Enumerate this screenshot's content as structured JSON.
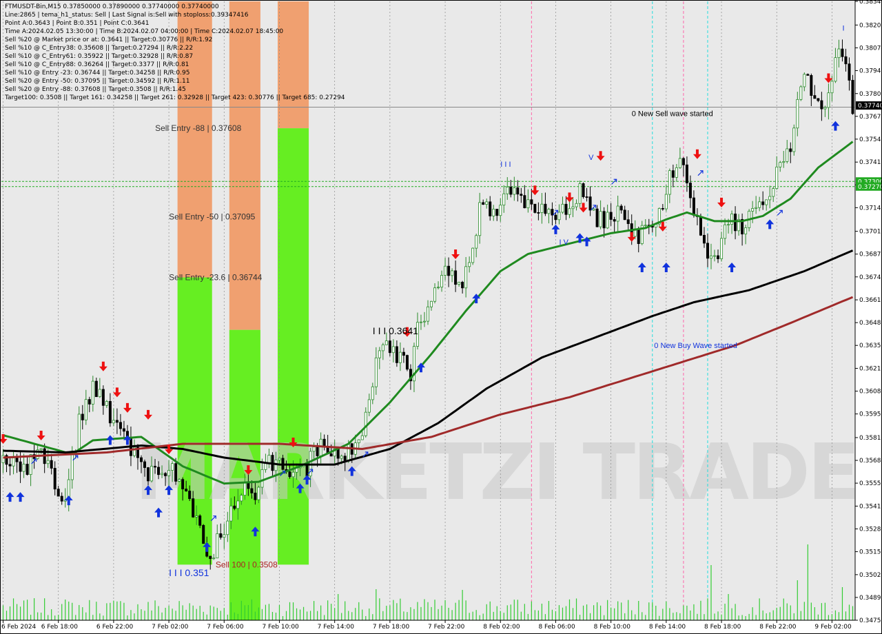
{
  "header": {
    "lines": [
      "FTMUSDT-Bin,M15  0.37850000 0.37890000 0.37740000 0.37740000",
      "Line:2865 | tema_h1_status: Sell | Last Signal is:Sell with stoploss:0.39347416",
      "Point A:0.3643 | Point B:0.351 | Point C:0.3641",
      "Time A:2024.02.05 13:30:00 | Time B:2024.02.07 04:00:00 | Time C:2024.02.07 18:45:00",
      "Sell %20 @ Market price or at: 0.3641 || Target:0.30776 || R/R:1.92",
      "Sell %10 @ C_Entry38: 0.35608 || Target:0.27294 || R/R:2.22",
      "Sell %10 @ C_Entry61: 0.35922 || Target:0.32928 || R/R:0.87",
      "Sell %10 @ C_Entry88: 0.36264 || Target:0.3377 || R/R:0.81",
      "Sell %10 @ Entry -23: 0.36744 || Target:0.34258 || R/R:0.95",
      "Sell %20 @ Entry -50: 0.37095 || Target:0.34592 || R/R:1.11",
      "Sell %20 @ Entry -88: 0.37608 || Target:0.3508 || R/R:1.45",
      "Target100: 0.3508 || Target 161: 0.34258 || Target 261: 0.32928 || Target 423: 0.30776 || Target 685: 0.27294"
    ]
  },
  "watermark": "MARKETZI TRADE",
  "colors": {
    "background": "#e9e9e9",
    "grid": "#8a8a8a",
    "bull": "#2a8a2a",
    "bear": "#000000",
    "ma_fast": "#1f8a1f",
    "ma_slow": "#000000",
    "ma_long": "#a02a2a",
    "zone_orange": "#f0a070",
    "zone_green": "#66ee22",
    "sell_arrow": "#ee1111",
    "buy_arrow": "#1133dd",
    "volume": "#33cc33",
    "magenta_line": "#ff66aa",
    "cyan_line": "#22dddd",
    "level_line": "#22aa22"
  },
  "chart_data": {
    "type": "candlestick",
    "symbol": "FTMUSDT-Bin",
    "timeframe": "M15",
    "ylim": [
      0.34758,
      0.38343
    ],
    "y_ticks": [
      0.38343,
      0.38206,
      0.38074,
      0.37942,
      0.37809,
      0.37677,
      0.37545,
      0.37412,
      0.3728,
      0.37148,
      0.37011,
      0.36879,
      0.36747,
      0.36614,
      0.36482,
      0.3635,
      0.36217,
      0.36085,
      0.35953,
      0.35816,
      0.35684,
      0.35552,
      0.35419,
      0.35287,
      0.35155,
      0.35022,
      0.3489,
      0.34758
    ],
    "x_labels": [
      "6 Feb 2024",
      "6 Feb 18:00",
      "6 Feb 22:00",
      "7 Feb 02:00",
      "7 Feb 06:00",
      "7 Feb 10:00",
      "7 Feb 14:00",
      "7 Feb 18:00",
      "7 Feb 22:00",
      "8 Feb 02:00",
      "8 Feb 06:00",
      "8 Feb 10:00",
      "8 Feb 14:00",
      "8 Feb 18:00",
      "8 Feb 22:00",
      "9 Feb 02:00"
    ],
    "x_label_index": [
      0,
      16,
      32,
      48,
      64,
      80,
      96,
      112,
      128,
      144,
      160,
      176,
      192,
      208,
      224,
      240
    ],
    "bar_count": 247,
    "close_path": [
      [
        0,
        0.3567
      ],
      [
        6,
        0.3561
      ],
      [
        10,
        0.358
      ],
      [
        14,
        0.356
      ],
      [
        18,
        0.3545
      ],
      [
        22,
        0.359
      ],
      [
        26,
        0.3612
      ],
      [
        30,
        0.3598
      ],
      [
        34,
        0.3585
      ],
      [
        38,
        0.357
      ],
      [
        42,
        0.3562
      ],
      [
        46,
        0.3565
      ],
      [
        50,
        0.356
      ],
      [
        54,
        0.3545
      ],
      [
        58,
        0.3525
      ],
      [
        60,
        0.3512
      ],
      [
        62,
        0.352
      ],
      [
        66,
        0.3538
      ],
      [
        70,
        0.3555
      ],
      [
        72,
        0.3545
      ],
      [
        76,
        0.3565
      ],
      [
        80,
        0.3572
      ],
      [
        84,
        0.356
      ],
      [
        88,
        0.3565
      ],
      [
        92,
        0.3578
      ],
      [
        96,
        0.357
      ],
      [
        100,
        0.3573
      ],
      [
        104,
        0.3582
      ],
      [
        106,
        0.3605
      ],
      [
        108,
        0.3625
      ],
      [
        110,
        0.364
      ],
      [
        114,
        0.3628
      ],
      [
        118,
        0.362
      ],
      [
        120,
        0.3645
      ],
      [
        124,
        0.3665
      ],
      [
        128,
        0.3682
      ],
      [
        132,
        0.3668
      ],
      [
        136,
        0.369
      ],
      [
        138,
        0.3718
      ],
      [
        142,
        0.3712
      ],
      [
        146,
        0.3728
      ],
      [
        150,
        0.3723
      ],
      [
        152,
        0.3715
      ],
      [
        156,
        0.3712
      ],
      [
        160,
        0.3705
      ],
      [
        164,
        0.3718
      ],
      [
        168,
        0.3726
      ],
      [
        170,
        0.3712
      ],
      [
        174,
        0.3706
      ],
      [
        178,
        0.3712
      ],
      [
        182,
        0.3698
      ],
      [
        186,
        0.37
      ],
      [
        190,
        0.3712
      ],
      [
        192,
        0.3728
      ],
      [
        196,
        0.374
      ],
      [
        198,
        0.3728
      ],
      [
        202,
        0.37
      ],
      [
        204,
        0.369
      ],
      [
        206,
        0.3683
      ],
      [
        208,
        0.3694
      ],
      [
        210,
        0.3706
      ],
      [
        214,
        0.3703
      ],
      [
        216,
        0.371
      ],
      [
        218,
        0.372
      ],
      [
        222,
        0.3718
      ],
      [
        224,
        0.3735
      ],
      [
        228,
        0.3752
      ],
      [
        230,
        0.3775
      ],
      [
        232,
        0.3796
      ],
      [
        234,
        0.3785
      ],
      [
        238,
        0.3772
      ],
      [
        240,
        0.379
      ],
      [
        242,
        0.3805
      ],
      [
        244,
        0.3793
      ],
      [
        246,
        0.3774
      ]
    ],
    "moving_averages": [
      {
        "color": "#1f8a1f",
        "values": [
          [
            0,
            0.3583
          ],
          [
            20,
            0.3572
          ],
          [
            26,
            0.358
          ],
          [
            40,
            0.3582
          ],
          [
            52,
            0.3565
          ],
          [
            64,
            0.3555
          ],
          [
            74,
            0.3556
          ],
          [
            86,
            0.3565
          ],
          [
            100,
            0.3578
          ],
          [
            112,
            0.3602
          ],
          [
            124,
            0.363
          ],
          [
            134,
            0.3655
          ],
          [
            144,
            0.3678
          ],
          [
            152,
            0.3688
          ],
          [
            164,
            0.3694
          ],
          [
            176,
            0.37
          ],
          [
            186,
            0.3703
          ],
          [
            192,
            0.3708
          ],
          [
            198,
            0.3712
          ],
          [
            206,
            0.3707
          ],
          [
            214,
            0.3707
          ],
          [
            220,
            0.371
          ],
          [
            228,
            0.372
          ],
          [
            236,
            0.3738
          ],
          [
            246,
            0.3753
          ]
        ]
      },
      {
        "color": "#000000",
        "values": [
          [
            0,
            0.3574
          ],
          [
            18,
            0.3573
          ],
          [
            40,
            0.3577
          ],
          [
            52,
            0.3575
          ],
          [
            64,
            0.357
          ],
          [
            80,
            0.3566
          ],
          [
            96,
            0.3566
          ],
          [
            112,
            0.3575
          ],
          [
            126,
            0.359
          ],
          [
            140,
            0.361
          ],
          [
            156,
            0.3628
          ],
          [
            172,
            0.364
          ],
          [
            188,
            0.3652
          ],
          [
            200,
            0.366
          ],
          [
            216,
            0.3667
          ],
          [
            232,
            0.3678
          ],
          [
            246,
            0.369
          ]
        ]
      },
      {
        "color": "#a02a2a",
        "values": [
          [
            0,
            0.357
          ],
          [
            30,
            0.3573
          ],
          [
            52,
            0.3578
          ],
          [
            80,
            0.3578
          ],
          [
            104,
            0.3575
          ],
          [
            124,
            0.3582
          ],
          [
            144,
            0.3595
          ],
          [
            164,
            0.3605
          ],
          [
            180,
            0.3615
          ],
          [
            196,
            0.3625
          ],
          [
            212,
            0.3635
          ],
          [
            228,
            0.3648
          ],
          [
            246,
            0.3663
          ]
        ]
      }
    ],
    "zones": [
      {
        "x0": 51,
        "x1": 61,
        "y0": 0.38343,
        "y1": 0.36744,
        "color": "orange"
      },
      {
        "x0": 51,
        "x1": 61,
        "y0": 0.36744,
        "y1": 0.3508,
        "color": "green"
      },
      {
        "x0": 66,
        "x1": 75,
        "y0": 0.38343,
        "y1": 0.3644,
        "color": "orange"
      },
      {
        "x0": 66,
        "x1": 75,
        "y0": 0.3644,
        "y1": 0.34758,
        "color": "green"
      },
      {
        "x0": 80,
        "x1": 89,
        "y0": 0.38343,
        "y1": 0.37608,
        "color": "orange"
      },
      {
        "x0": 80,
        "x1": 89,
        "y0": 0.37608,
        "y1": 0.3508,
        "color": "green"
      }
    ],
    "level_lines": [
      {
        "price": 0.3773,
        "color": "#888888",
        "dash": false
      },
      {
        "price": 0.373,
        "color": "#22aa22",
        "dash": true
      },
      {
        "price": 0.3727,
        "color": "#22aa22",
        "dash": true
      }
    ],
    "price_boxes": [
      {
        "price": 0.3774,
        "label": "0.37740",
        "bg": "#000000",
        "fg": "#ffffff"
      },
      {
        "price": 0.373,
        "label": "0.37300",
        "bg": "#22aa22",
        "fg": "#ffffff"
      },
      {
        "price": 0.3727,
        "label": "0.37270",
        "bg": "#22aa22",
        "fg": "#ffffff"
      }
    ],
    "vertical_lines": [
      {
        "x": 153,
        "color": "#ff66aa"
      },
      {
        "x": 188,
        "color": "#22dddd"
      },
      {
        "x": 197,
        "color": "#ff66aa"
      },
      {
        "x": 204,
        "color": "#22dddd"
      }
    ],
    "sell_arrows": [
      [
        0,
        0.3578
      ],
      [
        11,
        0.358
      ],
      [
        29,
        0.362
      ],
      [
        33,
        0.3605
      ],
      [
        36,
        0.3596
      ],
      [
        42,
        0.3592
      ],
      [
        48,
        0.3572
      ],
      [
        71,
        0.356
      ],
      [
        84,
        0.3576
      ],
      [
        117,
        0.364
      ],
      [
        131,
        0.3685
      ],
      [
        154,
        0.3722
      ],
      [
        164,
        0.3718
      ],
      [
        168,
        0.3712
      ],
      [
        173,
        0.3742
      ],
      [
        182,
        0.3695
      ],
      [
        191,
        0.3701
      ],
      [
        201,
        0.3743
      ],
      [
        208,
        0.3715
      ],
      [
        239,
        0.3787
      ]
    ],
    "buy_arrows": [
      [
        2,
        0.355
      ],
      [
        5,
        0.355
      ],
      [
        19,
        0.3548
      ],
      [
        31,
        0.3583
      ],
      [
        36,
        0.3583
      ],
      [
        42,
        0.3554
      ],
      [
        45,
        0.3541
      ],
      [
        48,
        0.3554
      ],
      [
        59,
        0.3521
      ],
      [
        73,
        0.353
      ],
      [
        86,
        0.3555
      ],
      [
        88,
        0.356
      ],
      [
        101,
        0.3565
      ],
      [
        121,
        0.3625
      ],
      [
        137,
        0.3665
      ],
      [
        160,
        0.3705
      ],
      [
        167,
        0.37
      ],
      [
        169,
        0.3698
      ],
      [
        185,
        0.3683
      ],
      [
        192,
        0.3683
      ],
      [
        211,
        0.3683
      ],
      [
        222,
        0.3708
      ],
      [
        241,
        0.3765
      ]
    ],
    "hollow_arrows": [
      [
        9,
        0.3568
      ],
      [
        21,
        0.357
      ],
      [
        61,
        0.3535
      ],
      [
        81,
        0.3561
      ],
      [
        89,
        0.3562
      ],
      [
        105,
        0.3572
      ],
      [
        160,
        0.3712
      ],
      [
        171,
        0.3715
      ],
      [
        177,
        0.373
      ],
      [
        202,
        0.3735
      ],
      [
        225,
        0.3712
      ]
    ],
    "annotations": [
      {
        "text": "Sell Entry -88 | 0.37608",
        "x": 56.5,
        "price": 0.37608,
        "color": "#333333",
        "size": 12,
        "anchor": "middle"
      },
      {
        "text": "Sell Entry -50 | 0.37095",
        "x": 60.5,
        "price": 0.37095,
        "color": "#333333",
        "size": 12,
        "anchor": "middle"
      },
      {
        "text": "Sell Entry -23.6 | 0.36744",
        "x": 61.5,
        "price": 0.36744,
        "color": "#333333",
        "size": 12,
        "anchor": "middle"
      },
      {
        "text": "Sell 100 | 0.3508",
        "x": 70.5,
        "price": 0.3508,
        "color": "#aa2222",
        "size": 12,
        "anchor": "middle"
      },
      {
        "text": "I I I 0.3641",
        "x": 107,
        "price": 0.3643,
        "color": "#000000",
        "size": 14,
        "anchor": "start"
      },
      {
        "text": "I I I 0.351",
        "x": 48,
        "price": 0.3503,
        "color": "#1133dd",
        "size": 14,
        "anchor": "start"
      },
      {
        "text": "I I I",
        "x": 144,
        "price": 0.374,
        "color": "#1133dd",
        "size": 11,
        "anchor": "start"
      },
      {
        "text": "I V",
        "x": 161,
        "price": 0.3695,
        "color": "#1133dd",
        "size": 11,
        "anchor": "start"
      },
      {
        "text": "V",
        "x": 169.5,
        "price": 0.3744,
        "color": "#1133dd",
        "size": 11,
        "anchor": "start"
      },
      {
        "text": "I",
        "x": 243,
        "price": 0.3819,
        "color": "#1133dd",
        "size": 11,
        "anchor": "start"
      },
      {
        "text": "0 New Sell wave started",
        "x": 182,
        "price": 0.37695,
        "color": "#000000",
        "size": 11,
        "anchor": "start"
      },
      {
        "text": "0 New Buy Wave started",
        "x": 188.5,
        "price": 0.3635,
        "color": "#1133dd",
        "size": 11,
        "anchor": "start"
      }
    ],
    "volume_spikes": [
      [
        184,
        28
      ],
      [
        210,
        38
      ],
      [
        230,
        58
      ],
      [
        233,
        110
      ],
      [
        243,
        48
      ],
      [
        205,
        80
      ],
      [
        97,
        38
      ],
      [
        108,
        45
      ],
      [
        133,
        44
      ]
    ]
  }
}
